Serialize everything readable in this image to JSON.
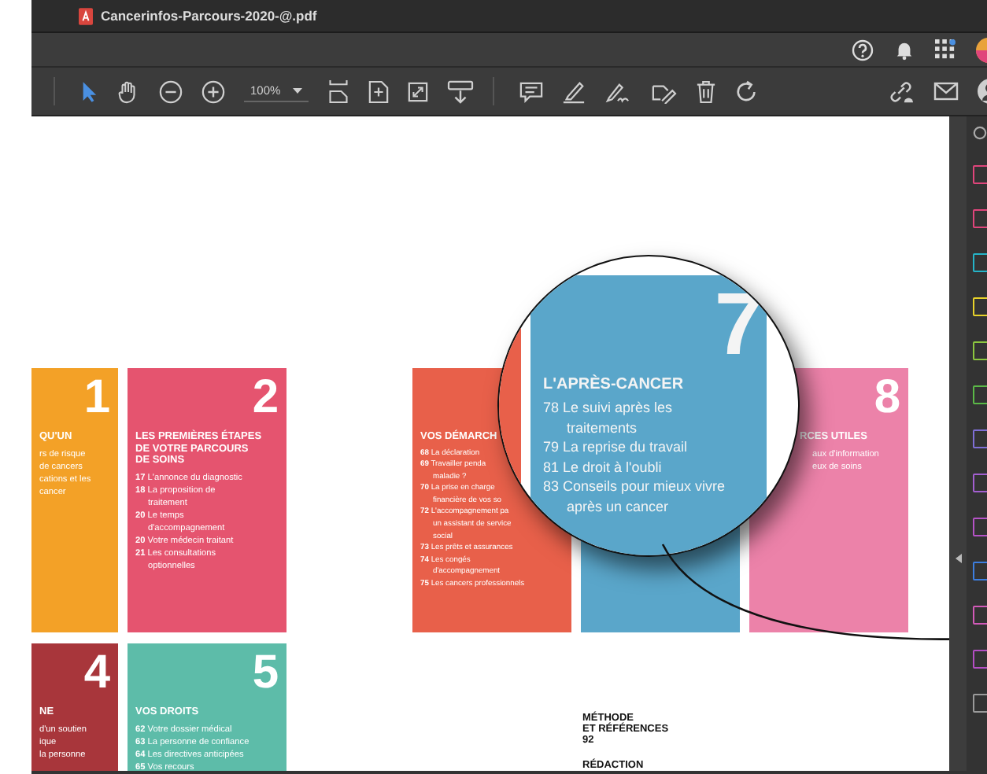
{
  "window": {
    "title": "Cancerinfos-Parcours-2020-@.pdf"
  },
  "header_icons": [
    {
      "kind": "help"
    },
    {
      "kind": "bell"
    },
    {
      "kind": "apps"
    },
    {
      "kind": "avatar"
    }
  ],
  "toolbar": {
    "zoom": "100%",
    "tools": [
      {
        "kind": "select",
        "selected": true
      },
      {
        "kind": "hand",
        "selected": false
      },
      {
        "kind": "zoom-out",
        "selected": false
      },
      {
        "kind": "zoom-in",
        "selected": false
      },
      {
        "kind": "zoom-level",
        "selected": false
      },
      {
        "kind": "fit-page",
        "selected": false
      },
      {
        "kind": "fit-width",
        "selected": false
      },
      {
        "kind": "full-screen",
        "selected": false
      },
      {
        "kind": "scroll",
        "selected": false
      },
      {
        "kind": "comment",
        "selected": false
      },
      {
        "kind": "highlight",
        "selected": false
      },
      {
        "kind": "sign",
        "selected": false
      },
      {
        "kind": "edit",
        "selected": false
      },
      {
        "kind": "delete",
        "selected": false
      },
      {
        "kind": "rotate",
        "selected": false
      },
      {
        "kind": "link",
        "selected": false
      },
      {
        "kind": "mail",
        "selected": false
      },
      {
        "kind": "account",
        "selected": false
      }
    ]
  },
  "document": {
    "tiles": [
      {
        "color": "#f3a127",
        "number": "1",
        "title": [
          "QU'UN"
        ],
        "lines": [
          {
            "text": "rs de risque"
          },
          {
            "text": "de cancers"
          },
          {
            "text": "cations et les"
          },
          {
            "text": "cancer"
          }
        ]
      },
      {
        "color": "#e5546f",
        "number": "2",
        "title": [
          "LES PREMIÈRES ÉTAPES",
          "DE VOTRE PARCOURS",
          "DE SOINS"
        ],
        "lines": [
          {
            "page": "17",
            "text": "L'annonce du diagnostic"
          },
          {
            "page": "18",
            "text": "La proposition de"
          },
          {
            "text": "traitement"
          },
          {
            "page": "20",
            "text": "Le temps"
          },
          {
            "text": "d'accompagnement"
          },
          {
            "page": "20",
            "text": "Votre médecin traitant"
          },
          {
            "page": "21",
            "text": "Les consultations"
          },
          {
            "text": "optionnelles"
          }
        ]
      },
      {
        "kind": "gap"
      },
      {
        "color": "#e8604a",
        "title": [
          "VOS DÉMARCH"
        ],
        "lines": [
          {
            "page": "68",
            "text": "La déclaration"
          },
          {
            "page": "69",
            "text": "Travailler penda"
          },
          {
            "text": "maladie ?"
          },
          {
            "page": "70",
            "text": "La prise en charge"
          },
          {
            "text": "financière de vos so"
          },
          {
            "page": "72",
            "text": "L'accompagnement pa"
          },
          {
            "text": "un assistant de service"
          },
          {
            "text": "social"
          },
          {
            "page": "73",
            "text": "Les prêts et assurances"
          },
          {
            "page": "74",
            "text": "Les congés"
          },
          {
            "text": "d'accompagnement"
          },
          {
            "page": "75",
            "text": "Les cancers professionnels"
          }
        ]
      },
      {
        "color": "#5aa6ca"
      },
      {
        "color": "#ec82a9",
        "number": "8",
        "title": [
          "RCES UTILES"
        ],
        "lines": [
          {
            "text": "aux d'information"
          },
          {
            "text": "eux de soins"
          }
        ]
      },
      {
        "color": "#a8363b",
        "number": "4",
        "title": [
          "NE"
        ],
        "lines": [
          {
            "text": "d'un soutien"
          },
          {
            "text": "ique"
          },
          {
            "text": "la personne"
          }
        ]
      },
      {
        "color": "#5dbca9",
        "number": "5",
        "title": [
          "VOS DROITS"
        ],
        "lines": [
          {
            "page": "62",
            "text": "Votre dossier médical"
          },
          {
            "page": "63",
            "text": "La personne de confiance"
          },
          {
            "page": "64",
            "text": "Les directives anticipées"
          },
          {
            "page": "65",
            "text": "Vos recours"
          }
        ]
      },
      {
        "kind": "gap"
      },
      {
        "kind": "gap"
      },
      {
        "kind": "text",
        "lines": [
          "MÉTHODE",
          "ET RÉFÉRENCES",
          "92"
        ],
        "heading": "RÉDACTION"
      }
    ],
    "magnifier": {
      "color": "#5aa6ca",
      "number": "7",
      "title": "L'APRÈS-CANCER",
      "lines": [
        {
          "page": "78",
          "text": "Le suivi après les"
        },
        {
          "text": "traitements"
        },
        {
          "page": "79",
          "text": "La reprise du travail"
        },
        {
          "page": "81",
          "text": "Le droit à l'oubli"
        },
        {
          "page": "83",
          "text": "Conseils pour mieux vivre"
        },
        {
          "text": "après un cancer"
        }
      ]
    }
  },
  "sidebar": {
    "tools": [
      {
        "color": "#e0457b"
      },
      {
        "color": "#e0457b"
      },
      {
        "color": "#25b4c8"
      },
      {
        "color": "#e8d22a"
      },
      {
        "color": "#8cc63f"
      },
      {
        "color": "#5bb947"
      },
      {
        "color": "#7f6fd6"
      },
      {
        "color": "#a35fd0"
      },
      {
        "color": "#b553c7"
      },
      {
        "color": "#3d7ee0"
      },
      {
        "color": "#d25ab8"
      },
      {
        "color": "#b44ec4"
      },
      {
        "color": "#9a9a9a"
      }
    ]
  }
}
